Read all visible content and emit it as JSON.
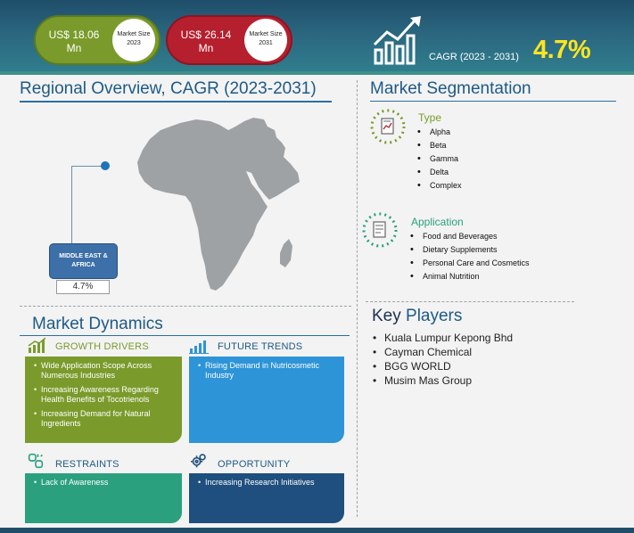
{
  "header": {
    "market_2023": {
      "value": "US$ 18.06 Mn",
      "label": "Market Size 2023",
      "color": "#7a9b2b"
    },
    "market_2031": {
      "value": "US$ 26.14 Mn",
      "label": "Market Size 2031",
      "color": "#b51f2e"
    },
    "cagr_label": "CAGR (2023 - 2031)",
    "cagr_value": "4.7%",
    "cagr_color": "#ffe51f",
    "icon": "growth-chart-icon"
  },
  "regional": {
    "title": "Regional Overview, CAGR (2023-2031)",
    "region_label": "MIDDLE EAST & AFRICA",
    "region_value": "4.7%",
    "map_icon": "middle-east-africa-map"
  },
  "segmentation": {
    "title": "Market Segmentation",
    "groups": [
      {
        "name": "Type",
        "icon": "type-document-icon",
        "items": [
          "Alpha",
          "Beta",
          "Gamma",
          "Delta",
          "Complex"
        ]
      },
      {
        "name": "Application",
        "icon": "application-document-icon",
        "items": [
          "Food and Beverages",
          "Dietary Supplements",
          "Personal Care and Cosmetics",
          "Animal Nutrition"
        ]
      }
    ]
  },
  "key_players": {
    "title_a": "Key",
    "title_b": "Players",
    "items": [
      "Kuala Lumpur Kepong Bhd",
      "Cayman Chemical",
      "BGG WORLD",
      "Musim Mas Group"
    ]
  },
  "dynamics": {
    "title": "Market Dynamics",
    "growth_drivers": {
      "label": "GROWTH DRIVERS",
      "icon": "bar-chart-icon",
      "color": "#7a9b2b",
      "items": [
        "Wide Application Scope Across Numerous Industries",
        "Increasing Awareness Regarding Health Benefits of Tocotrienols",
        "Increasing Demand for Natural Ingredients"
      ]
    },
    "future_trends": {
      "label": "FUTURE TRENDS",
      "icon": "trend-chart-icon",
      "color": "#2e94d8",
      "items": [
        "Rising Demand in Nutricosmetic Industry"
      ]
    },
    "restraints": {
      "label": "RESTRAINTS",
      "icon": "broken-link-icon",
      "color": "#2aa07f",
      "items": [
        "Lack of Awareness"
      ]
    },
    "opportunity": {
      "label": "OPPORTUNITY",
      "icon": "gears-icon",
      "color": "#1f4f7e",
      "items": [
        "Increasing Research Initiatives"
      ]
    }
  }
}
